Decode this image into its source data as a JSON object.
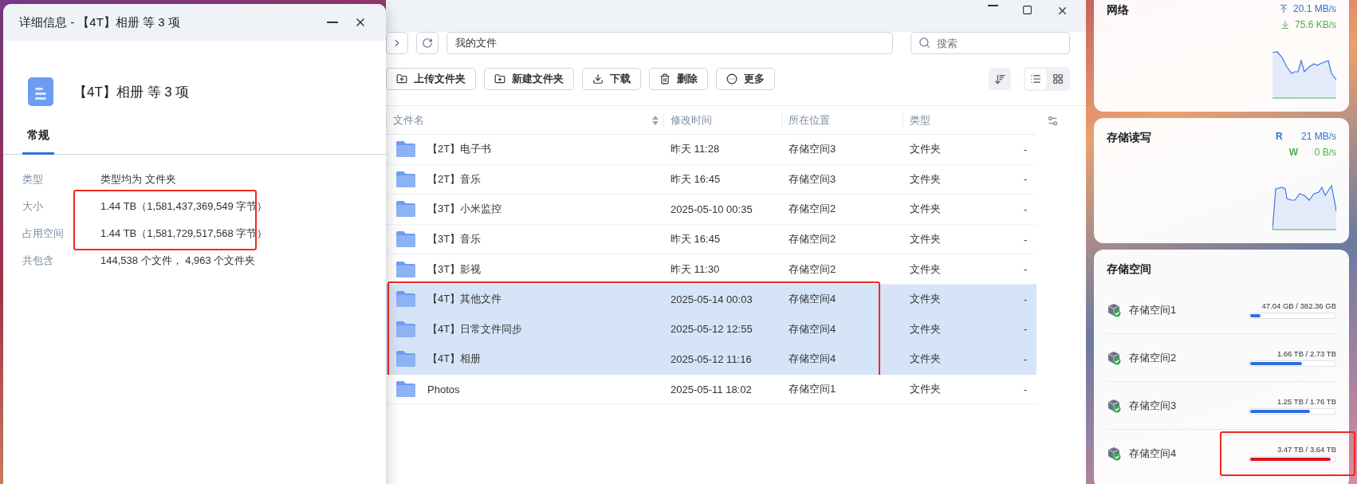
{
  "details_dialog": {
    "title": "详细信息 - 【4T】相册 等 3 项",
    "name": "【4T】相册 等 3 项",
    "tabs": [
      {
        "label": "常规",
        "selected": true
      }
    ],
    "fields": [
      {
        "label": "类型",
        "value": "类型均为 文件夹",
        "highlighted": false
      },
      {
        "label": "大小",
        "value": "1.44 TB（1,581,437,369,549 字节）",
        "highlighted": true
      },
      {
        "label": "占用空间",
        "value": "1.44 TB（1,581,729,517,568 字节）",
        "highlighted": true
      },
      {
        "label": "共包含",
        "value": "144,538 个文件， 4,963 个文件夹",
        "highlighted": false
      }
    ]
  },
  "file_manager": {
    "path": "我的文件",
    "search": {
      "placeholder": "搜索"
    },
    "toolbar": [
      {
        "kind": "upload",
        "label": "上传文件夹"
      },
      {
        "kind": "new-folder",
        "label": "新建文件夹"
      },
      {
        "kind": "download",
        "label": "下载"
      },
      {
        "kind": "delete",
        "label": "删除"
      },
      {
        "kind": "more",
        "label": "更多"
      }
    ],
    "view_modes": [
      {
        "kind": "list",
        "selected": true
      },
      {
        "kind": "grid",
        "selected": false
      }
    ],
    "columns": [
      "文件名",
      "修改时间",
      "所在位置",
      "类型"
    ],
    "rows": [
      {
        "name": "【2T】电子书",
        "modified": "昨天 11:28",
        "location": "存储空间3",
        "type": "文件夹",
        "size": "-",
        "selected": false,
        "highlighted": false
      },
      {
        "name": "【2T】音乐",
        "modified": "昨天 16:45",
        "location": "存储空间3",
        "type": "文件夹",
        "size": "-",
        "selected": false,
        "highlighted": false
      },
      {
        "name": "【3T】小米监控",
        "modified": "2025-05-10 00:35",
        "location": "存储空间2",
        "type": "文件夹",
        "size": "-",
        "selected": false,
        "highlighted": false
      },
      {
        "name": "【3T】音乐",
        "modified": "昨天 16:45",
        "location": "存储空间2",
        "type": "文件夹",
        "size": "-",
        "selected": false,
        "highlighted": false
      },
      {
        "name": "【3T】影视",
        "modified": "昨天 11:30",
        "location": "存储空间2",
        "type": "文件夹",
        "size": "-",
        "selected": false,
        "highlighted": false
      },
      {
        "name": "【4T】其他文件",
        "modified": "2025-05-14 00:03",
        "location": "存储空间4",
        "type": "文件夹",
        "size": "-",
        "selected": true,
        "highlighted": true
      },
      {
        "name": "【4T】日常文件同步",
        "modified": "2025-05-12 12:55",
        "location": "存储空间4",
        "type": "文件夹",
        "size": "-",
        "selected": true,
        "highlighted": true
      },
      {
        "name": "【4T】相册",
        "modified": "2025-05-12 11:16",
        "location": "存储空间4",
        "type": "文件夹",
        "size": "-",
        "selected": true,
        "highlighted": true
      },
      {
        "name": "Photos",
        "modified": "2025-05-11 18:02",
        "location": "存储空间1",
        "type": "文件夹",
        "size": "-",
        "selected": false,
        "highlighted": false
      }
    ]
  },
  "widgets": {
    "network": {
      "title": "网络",
      "upload": "20.1 MB/s",
      "download": "75.6 KB/s"
    },
    "storage_io": {
      "title": "存储读写",
      "read_label": "R",
      "read": "21 MB/s",
      "write_label": "W",
      "write": "0 B/s"
    },
    "storage": {
      "title": "存储空间",
      "volumes": [
        {
          "name": "存储空间1",
          "usage": "47.04 GB / 382.36 GB",
          "level": 0.12,
          "color": "#2f6fd8",
          "highlighted": false
        },
        {
          "name": "存储空间2",
          "usage": "1.66 TB / 2.73 TB",
          "level": 0.61,
          "color": "#2f6fd8",
          "highlighted": false
        },
        {
          "name": "存储空间3",
          "usage": "1.25 TB / 1.76 TB",
          "level": 0.71,
          "color": "#2f6fd8",
          "highlighted": false
        },
        {
          "name": "存储空间4",
          "usage": "3.47 TB / 3.64 TB",
          "level": 0.95,
          "color": "#e0101e",
          "highlighted": true
        }
      ]
    }
  }
}
